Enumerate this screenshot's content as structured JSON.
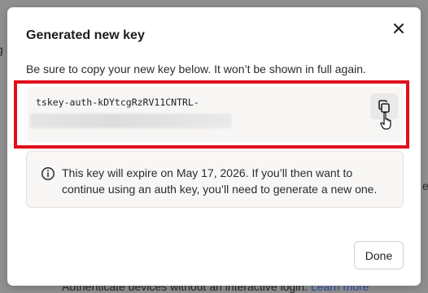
{
  "background": {
    "left_fragment": "g",
    "right_fragment": "e",
    "bottom_text": "Authenticate devices without an interactive login.",
    "bottom_link": "Learn more"
  },
  "dialog": {
    "title": "Generated new key",
    "close_icon": "close-icon",
    "intro": "Be sure to copy your new key below. It won’t be shown in full again.",
    "key_visible": "tskey-auth-kDYtcgRzRV11CNTRL-",
    "copy_icon": "copy-icon",
    "info_icon": "info-icon",
    "info_text": "This key will expire on May 17, 2026. If you’ll then want to continue using an auth key, you’ll need to generate a new one.",
    "done_label": "Done"
  },
  "colors": {
    "highlight": "#e0101a",
    "link": "#2a4fa8"
  }
}
